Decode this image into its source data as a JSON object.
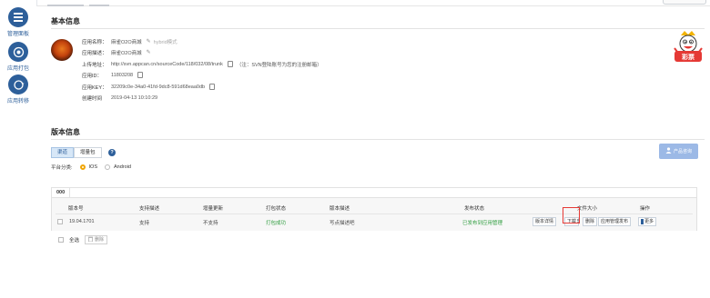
{
  "sidebar": {
    "items": [
      {
        "label": "管理面板",
        "icon": "dashboard-icon"
      },
      {
        "label": "应用打包",
        "icon": "package-icon"
      },
      {
        "label": "应用转移",
        "icon": "transfer-icon"
      }
    ]
  },
  "basic_info": {
    "title": "基本信息",
    "name_label": "应用名称：",
    "name_value": "麻雀O2O商城",
    "hybrid_tag": "hybrid模式",
    "desc_label": "应用描述：",
    "desc_value": "麻雀O2O商城",
    "svn_label": "上传地址：",
    "svn_value": "http://svn.appcan.cn/sourceCode/118/032/08/trunk",
    "svn_note": "（注：SVN登陆账号为您的注册邮箱）",
    "id_label": "应用ID：",
    "id_value": "11803208",
    "key_label": "应用KEY：",
    "key_value": "32209c0e-34a0-41fd-9dc8-591d68eaa0db",
    "created_label": "创建时间",
    "created_value": "2019-04-13 10:10:29",
    "mascot_text": "彩票"
  },
  "version_info": {
    "title": "版本信息",
    "tabs": [
      "渠道",
      "增量包"
    ],
    "help": "?",
    "product_button": "产品咨询",
    "platform_label": "平台分类:",
    "platforms": [
      "IOS",
      "Android"
    ],
    "selected_platform": "IOS",
    "version_tab": "000",
    "columns": [
      "版本号",
      "支持描述",
      "增量更新",
      "打包状态",
      "版本描述",
      "发布状态",
      "文件大小",
      "操作"
    ],
    "row": {
      "version": "19.04.1701",
      "support": "支持",
      "incremental": "不支持",
      "build_status": "打包成功",
      "description": "写点描述吧",
      "publish_status": "已发布到应用管理",
      "btn_detail": "版本详情",
      "btn_download": "下载",
      "file_size": "5",
      "btn_delete": "删除",
      "btn_publish": "应用管理发布",
      "btn_more": "更多"
    },
    "select_all": "全选",
    "bulk_delete": "删除"
  },
  "colors": {
    "accent": "#2d5f9a",
    "success": "#2e9c3e",
    "highlight": "#e53935",
    "radio_on": "#f0a500"
  }
}
